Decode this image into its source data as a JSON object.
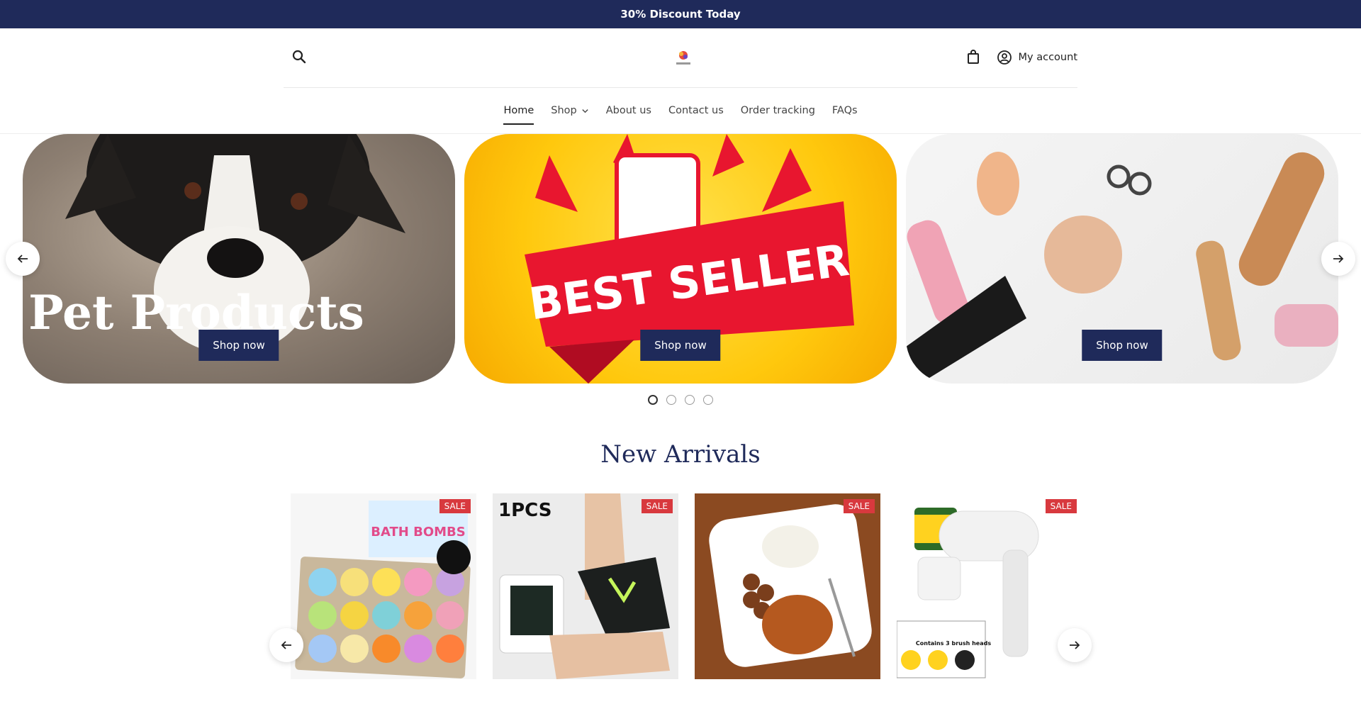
{
  "announcement": {
    "text": "30% Discount Today"
  },
  "header": {
    "search_icon": "search-icon",
    "logo_name": "store-logo",
    "cart_icon": "shopping-bag-icon",
    "account_label": "My account"
  },
  "nav": {
    "items": [
      {
        "label": "Home",
        "active": true
      },
      {
        "label": "Shop",
        "has_dropdown": true
      },
      {
        "label": "About us"
      },
      {
        "label": "Contact us"
      },
      {
        "label": "Order tracking"
      },
      {
        "label": "FAQs"
      }
    ]
  },
  "slideshow": {
    "slides": [
      {
        "heading": "Pet Products",
        "button": "Shop now"
      },
      {
        "heading": "BEST SELLER",
        "button": "Shop now"
      },
      {
        "heading": "",
        "button": "Shop now"
      }
    ],
    "dots_count": 4,
    "active_dot": 0
  },
  "new_arrivals": {
    "title": "New Arrivals",
    "products": [
      {
        "badge": "SALE",
        "image_text": "BATH BOMBS"
      },
      {
        "badge": "SALE",
        "image_text": "1PCS"
      },
      {
        "badge": "SALE",
        "image_text": ""
      },
      {
        "badge": "SALE",
        "image_text": "Contains 3 brush heads"
      }
    ]
  },
  "colors": {
    "brand_navy": "#1f2a5a",
    "sale_red": "#d8393e"
  }
}
